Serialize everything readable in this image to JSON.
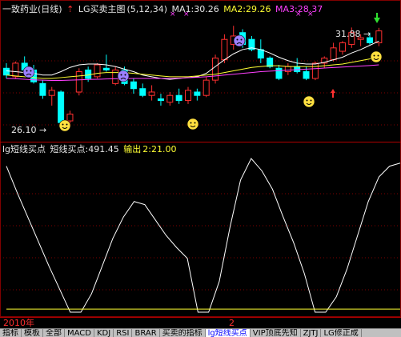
{
  "main_header": {
    "title": "一致药业(日线)",
    "indicator": "LG买卖主图",
    "params": "(5,12,34)",
    "ma1": "MA1:30.26",
    "ma2": "MA2:29.26",
    "ma3": "MA3:28.37"
  },
  "indicator_header": {
    "name": "lg短线买点",
    "value_label": "短线买点:491.45",
    "output_label": "输出",
    "output_value": "2:21.00"
  },
  "annotations": {
    "high_price": "31.88",
    "low_price": "26.10"
  },
  "time_axis": {
    "year_label": "2010年",
    "month_label": "2"
  },
  "tabs": [
    {
      "label": "指标",
      "active": false
    },
    {
      "label": "模板",
      "active": false
    },
    {
      "label": "全部",
      "active": false
    },
    {
      "label": "MACD",
      "active": false
    },
    {
      "label": "KDJ",
      "active": false
    },
    {
      "label": "RSI",
      "active": false
    },
    {
      "label": "BRAR",
      "active": false
    },
    {
      "label": "买卖的指标",
      "active": false
    },
    {
      "label": "lg短线买点",
      "active": true
    },
    {
      "label": "VIP顶底先知",
      "active": false
    },
    {
      "label": "ZJTJ",
      "active": false
    },
    {
      "label": "LG修正成",
      "active": false
    }
  ],
  "colors": {
    "background": "#000000",
    "up_candle": "#ff3030",
    "down_candle": "#00ffff",
    "ma1": "#ffffff",
    "ma2": "#ffff33",
    "ma3": "#ff40ff",
    "indicator_line": "#ffffff",
    "baseline": "#ffff33",
    "grid": "#800000"
  },
  "chart_data": [
    {
      "type": "candlestick",
      "title": "一致药业(日线)",
      "series": [
        {
          "name": "MA1",
          "values": [
            29.35,
            29.3,
            29.25,
            29.2,
            29.1,
            29.1,
            29.3,
            29.55,
            29.7,
            29.75,
            29.75,
            29.7,
            29.6,
            29.45,
            29.3,
            29.1,
            29.0,
            28.9,
            28.85,
            28.9,
            28.95,
            29.0,
            29.2,
            29.6,
            30.0,
            30.35,
            30.6,
            30.7,
            30.6,
            30.4,
            30.15,
            29.95,
            29.8,
            29.75,
            29.75,
            29.85,
            30.0,
            30.15,
            30.4,
            30.6,
            30.85,
            31.1
          ]
        },
        {
          "name": "MA2",
          "values": [
            29.1,
            29.05,
            29.0,
            28.95,
            28.9,
            28.9,
            28.95,
            29.0,
            29.05,
            29.1,
            29.2,
            29.25,
            29.25,
            29.25,
            29.2,
            29.15,
            29.1,
            29.05,
            29.0,
            29.0,
            29.0,
            29.05,
            29.1,
            29.15,
            29.25,
            29.35,
            29.45,
            29.55,
            29.6,
            29.65,
            29.65,
            29.6,
            29.6,
            29.6,
            29.6,
            29.65,
            29.7,
            29.75,
            29.85,
            29.95,
            30.05,
            30.2
          ]
        },
        {
          "name": "MA3",
          "values": [
            28.9,
            28.88,
            28.85,
            28.82,
            28.8,
            28.78,
            28.78,
            28.8,
            28.82,
            28.84,
            28.85,
            28.87,
            28.88,
            28.89,
            28.9,
            28.9,
            28.9,
            28.9,
            28.9,
            28.92,
            28.94,
            28.97,
            29.0,
            29.05,
            29.1,
            29.15,
            29.2,
            29.25,
            29.3,
            29.33,
            29.36,
            29.39,
            29.42,
            29.45,
            29.48,
            29.51,
            29.54,
            29.57,
            29.6,
            29.63,
            29.66,
            29.7
          ]
        }
      ],
      "ohlc": [
        [
          29.5,
          29.8,
          28.9,
          29.1
        ],
        [
          29.0,
          29.9,
          28.9,
          29.8
        ],
        [
          29.8,
          30.2,
          29.3,
          29.4
        ],
        [
          29.4,
          29.7,
          28.6,
          28.7
        ],
        [
          28.6,
          28.8,
          27.7,
          27.9
        ],
        [
          27.9,
          28.4,
          27.3,
          28.2
        ],
        [
          28.1,
          28.2,
          26.1,
          26.3
        ],
        [
          26.4,
          27.0,
          26.2,
          26.8
        ],
        [
          28.1,
          29.5,
          27.9,
          29.3
        ],
        [
          29.4,
          29.6,
          28.7,
          28.9
        ],
        [
          29.0,
          29.8,
          28.9,
          29.7
        ],
        [
          29.5,
          30.3,
          29.3,
          29.4
        ],
        [
          28.6,
          29.6,
          28.5,
          29.4
        ],
        [
          29.4,
          29.6,
          28.5,
          28.6
        ],
        [
          28.7,
          28.9,
          28.0,
          28.3
        ],
        [
          28.3,
          28.6,
          27.8,
          27.9
        ],
        [
          27.9,
          28.5,
          27.6,
          28.1
        ],
        [
          27.7,
          28.0,
          27.3,
          27.6
        ],
        [
          27.5,
          28.1,
          27.3,
          27.9
        ],
        [
          27.9,
          28.3,
          27.4,
          27.6
        ],
        [
          27.6,
          28.4,
          27.4,
          28.2
        ],
        [
          28.1,
          28.3,
          27.6,
          27.9
        ],
        [
          27.9,
          29.0,
          27.8,
          28.8
        ],
        [
          28.8,
          30.3,
          28.6,
          30.1
        ],
        [
          30.0,
          31.5,
          29.8,
          31.2
        ],
        [
          30.9,
          32.0,
          30.6,
          31.4
        ],
        [
          31.6,
          31.8,
          30.7,
          30.9
        ],
        [
          31.2,
          31.4,
          30.5,
          30.6
        ],
        [
          30.6,
          31.2,
          29.8,
          30.1
        ],
        [
          30.1,
          30.2,
          29.5,
          29.6
        ],
        [
          29.5,
          29.7,
          28.8,
          28.9
        ],
        [
          29.3,
          29.8,
          29.1,
          29.6
        ],
        [
          29.6,
          30.1,
          29.2,
          29.3
        ],
        [
          29.3,
          29.6,
          28.8,
          28.9
        ],
        [
          28.9,
          29.9,
          28.8,
          29.8
        ],
        [
          29.8,
          30.2,
          29.5,
          30.1
        ],
        [
          30.0,
          31.0,
          29.9,
          30.7
        ],
        [
          30.5,
          31.1,
          30.3,
          31.0
        ],
        [
          30.9,
          31.9,
          30.7,
          31.6
        ],
        [
          31.2,
          31.5,
          30.8,
          31.3
        ],
        [
          31.3,
          31.6,
          30.9,
          31.0
        ],
        [
          31.0,
          31.88,
          30.8,
          31.7
        ]
      ],
      "annotations": [
        "31.88",
        "26.10"
      ]
    },
    {
      "type": "line",
      "title": "lg短线买点",
      "series": [
        {
          "name": "短线买点",
          "values": [
            95,
            78,
            62,
            46,
            30,
            15,
            0,
            0,
            12,
            30,
            48,
            62,
            72,
            70,
            60,
            50,
            42,
            35,
            0,
            0,
            20,
            55,
            86,
            100,
            92,
            80,
            62,
            45,
            25,
            0,
            0,
            10,
            28,
            50,
            72,
            88,
            95,
            97
          ]
        },
        {
          "name": "输出",
          "values": [
            2,
            2,
            2,
            2,
            2,
            2,
            2,
            2,
            2,
            2,
            2,
            2,
            2,
            2,
            2,
            2,
            2,
            2,
            2,
            2,
            2,
            2,
            2,
            2,
            2,
            2,
            2,
            2,
            2,
            2,
            2,
            2,
            2,
            2,
            2,
            2,
            2,
            2
          ]
        }
      ]
    }
  ]
}
